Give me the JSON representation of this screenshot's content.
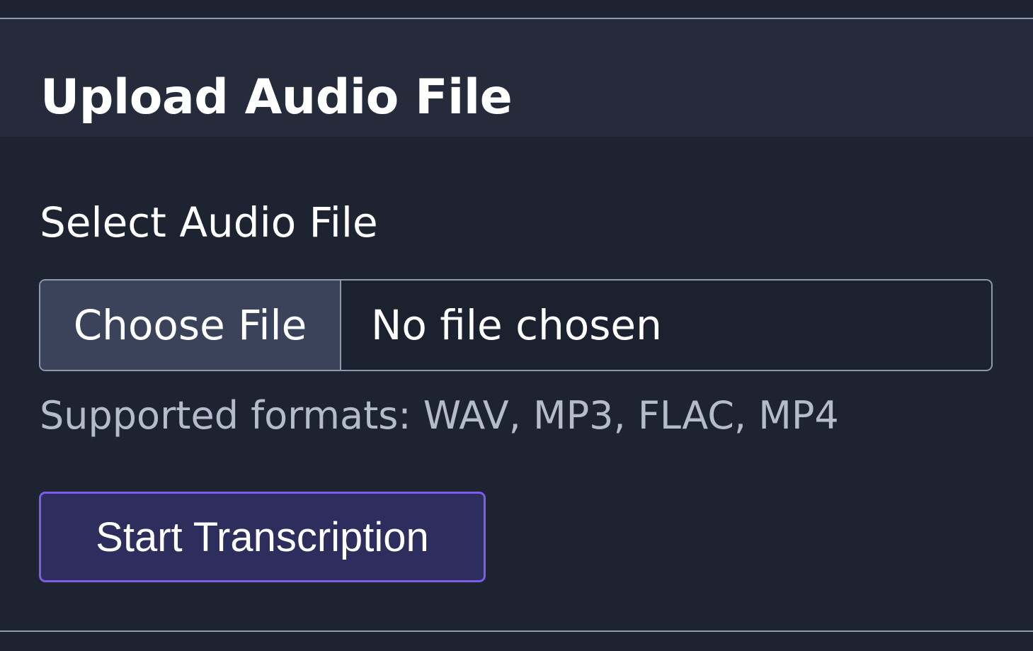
{
  "card": {
    "title": "Upload Audio File"
  },
  "form": {
    "field_label": "Select Audio File",
    "choose_button_label": "Choose File",
    "file_status": "No file chosen",
    "hint": "Supported formats: WAV, MP3, FLAC, MP4",
    "submit_label": "Start Transcription"
  },
  "colors": {
    "background": "#1e2332",
    "header_background": "#252b3b",
    "border": "#8e99ad",
    "choose_button_bg": "#3a435a",
    "primary_border": "#7c5ce8",
    "primary_bg": "#2e2e5e",
    "hint_text": "#b4bccb"
  }
}
